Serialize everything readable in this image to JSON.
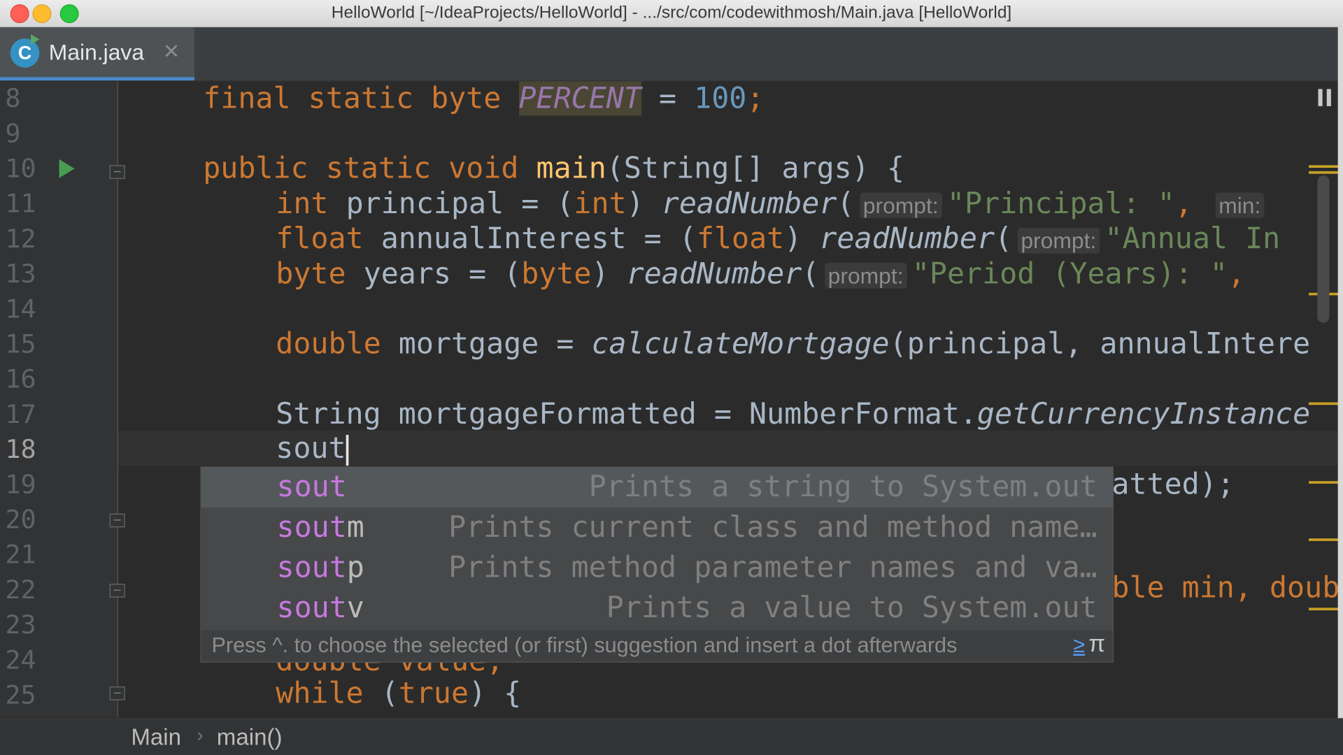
{
  "window": {
    "title": "HelloWorld [~/IdeaProjects/HelloWorld] - .../src/com/codewithmosh/Main.java [HelloWorld]"
  },
  "tab": {
    "icon_letter": "C",
    "label": "Main.java",
    "close_glyph": "✕"
  },
  "gutter": {
    "line_numbers": [
      "8",
      "9",
      "10",
      "11",
      "12",
      "13",
      "14",
      "15",
      "16",
      "17",
      "18",
      "19",
      "20",
      "21",
      "22",
      "23",
      "24",
      "25"
    ],
    "active_line": "18"
  },
  "code": {
    "l8": {
      "final": "final",
      "static": "static",
      "byte": "byte",
      "const": "PERCENT",
      "eq": " = ",
      "num": "100",
      "semi": ";"
    },
    "l10": {
      "public": "public",
      "static": "static",
      "void": "void",
      "fn": "main",
      "rest": "(String[] args) {"
    },
    "l11": {
      "type": "int",
      "var": " principal = (",
      "cast": "int",
      "close": ") ",
      "call": "readNumber",
      "open": "(",
      "hint": "prompt:",
      "str": "\"Principal: \"",
      "comma": ", ",
      "hint2": "min:"
    },
    "l12": {
      "type": "float",
      "var": " annualInterest = (",
      "cast": "float",
      "close": ") ",
      "call": "readNumber",
      "open": "(",
      "hint": "prompt:",
      "str": "\"Annual In"
    },
    "l13": {
      "type": "byte",
      "var": " years = (",
      "cast": "byte",
      "close": ") ",
      "call": "readNumber",
      "open": "(",
      "hint": "prompt:",
      "str": "\"Period (Years): \"",
      "comma": ","
    },
    "l15": {
      "type": "double",
      "var": " mortgage = ",
      "call": "calculateMortgage",
      "rest": "(principal, annualIntere"
    },
    "l17": {
      "var": "String mortgageFormatted = NumberFormat.",
      "call": "getCurrencyInstance"
    },
    "l18": {
      "typed": "sout"
    },
    "l19": {
      "tail": "atted);"
    },
    "l22": {
      "tail1": "ble min, ",
      "tail2": "doub"
    },
    "l24": {
      "text": "double value;"
    },
    "l25": {
      "kw": "while",
      "open": " (",
      "val": "true",
      "close": ") {"
    }
  },
  "autocomplete": {
    "items": [
      {
        "prefix": "sout",
        "suffix": "",
        "description": "Prints a string to System.out",
        "selected": true
      },
      {
        "prefix": "sout",
        "suffix": "m",
        "description": "Prints current class and method name…",
        "selected": false
      },
      {
        "prefix": "sout",
        "suffix": "p",
        "description": "Prints method parameter names and va…",
        "selected": false
      },
      {
        "prefix": "sout",
        "suffix": "v",
        "description": "Prints a value to System.out",
        "selected": false
      }
    ],
    "footer": "Press ^. to choose the selected (or first) suggestion and insert a dot afterwards",
    "footer_link": "≥",
    "footer_symbol": "π"
  },
  "breadcrumb": {
    "items": [
      "Main",
      "main()"
    ],
    "separator": "›"
  },
  "colors": {
    "editor_bg": "#2b2b2b",
    "keyword": "#cc7832",
    "number": "#6897bb",
    "string": "#6a8759",
    "function": "#ffc66d",
    "constant": "#9876aa",
    "tab_underline": "#4a88c7"
  }
}
